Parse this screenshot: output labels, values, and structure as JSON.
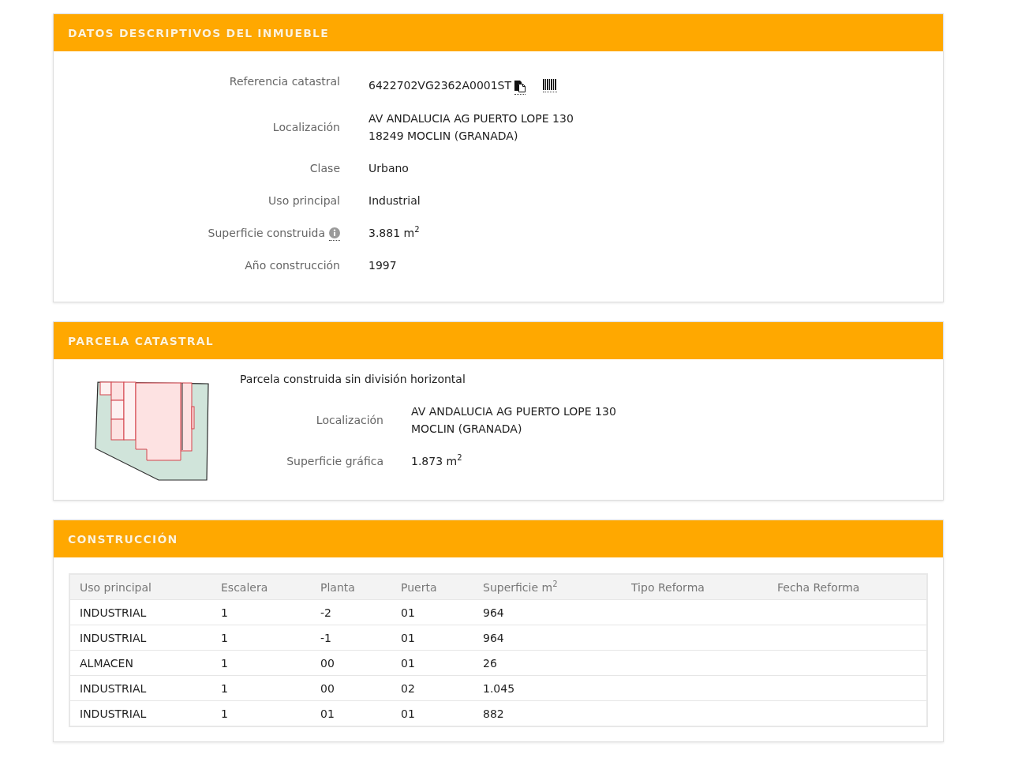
{
  "property_details": {
    "title": "DATOS DESCRIPTIVOS DEL INMUEBLE",
    "fields": [
      {
        "kind": "reference",
        "label": "Referencia catastral",
        "value": [
          "6422702VG2362A0001ST"
        ]
      },
      {
        "kind": "text",
        "label": "Localización",
        "value": [
          "AV ANDALUCIA AG PUERTO LOPE 130",
          "18249 MOCLIN (GRANADA)"
        ]
      },
      {
        "kind": "text",
        "label": "Clase",
        "value": [
          "Urbano"
        ]
      },
      {
        "kind": "text",
        "label": "Uso principal",
        "value": [
          "Industrial"
        ]
      },
      {
        "kind": "info",
        "label": "Superficie construida",
        "value": [
          "3.881 m$^{2}$"
        ]
      },
      {
        "kind": "text",
        "label": "Año construcción",
        "value": [
          "1997"
        ]
      }
    ]
  },
  "cadastral_parcel": {
    "title": "PARCELA CATASTRAL",
    "description": "Parcela construida sin división horizontal",
    "fields": [
      {
        "kind": "text",
        "label": "Localización",
        "value": [
          "AV ANDALUCIA AG PUERTO LOPE 130",
          "MOCLIN (GRANADA)"
        ]
      },
      {
        "kind": "text",
        "label": "Superficie gráfica",
        "value": [
          "1.873 m$^{2}$"
        ]
      }
    ]
  },
  "construction": {
    "title": "CONSTRUCCIÓN",
    "table": {
      "columns": [
        "Uso principal",
        "Escalera",
        "Planta",
        "Puerta",
        "Superficie m$^{2}$",
        "Tipo Reforma",
        "Fecha Reforma"
      ],
      "rows": [
        [
          "INDUSTRIAL",
          "1",
          "-2",
          "01",
          "964"
        ],
        [
          "INDUSTRIAL",
          "1",
          "-1",
          "01",
          "964"
        ],
        [
          "ALMACEN",
          "1",
          "00",
          "01",
          "26"
        ],
        [
          "INDUSTRIAL",
          "1",
          "00",
          "02",
          "1.045"
        ],
        [
          "INDUSTRIAL",
          "1",
          "01",
          "01",
          "882"
        ]
      ]
    }
  }
}
